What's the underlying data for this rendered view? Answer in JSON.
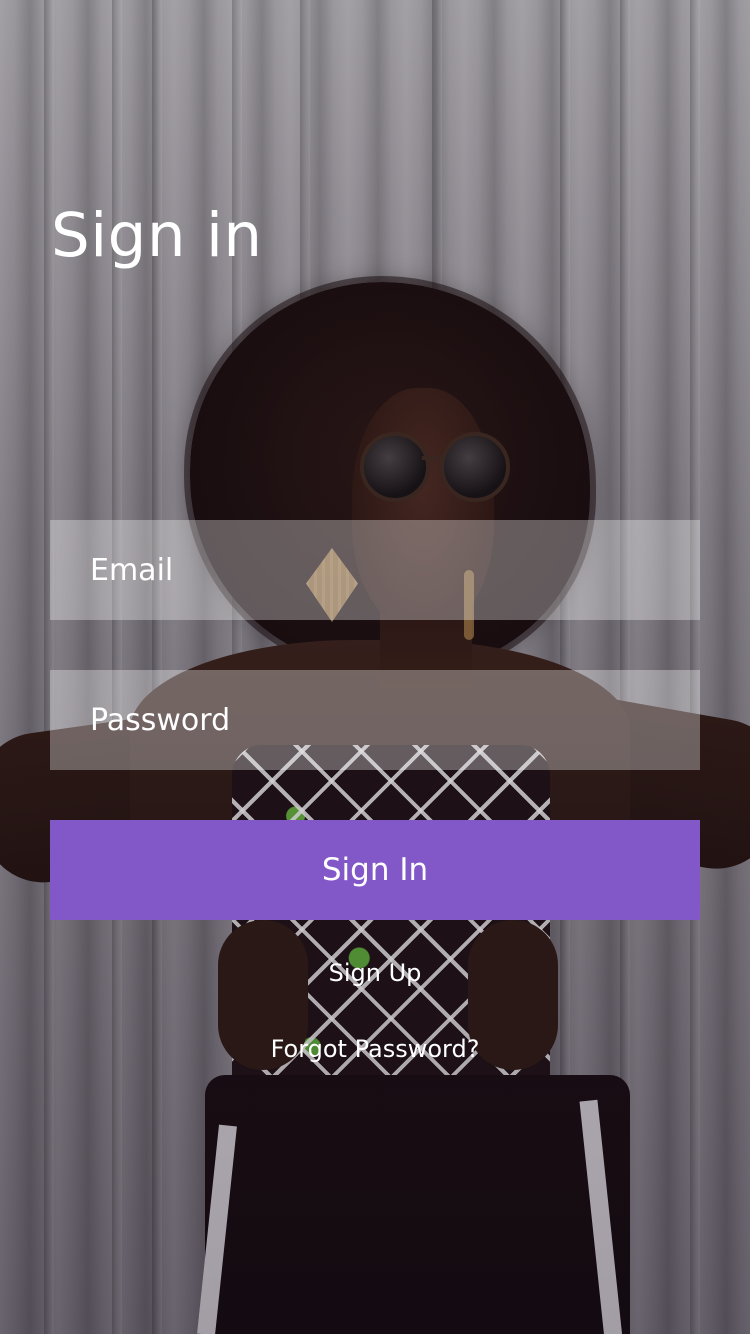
{
  "page": {
    "title": "Sign in"
  },
  "form": {
    "email_placeholder": "Email",
    "password_placeholder": "Password",
    "submit_label": "Sign In"
  },
  "links": {
    "signup_label": "Sign Up",
    "forgot_label": "Forgot Password?"
  },
  "colors": {
    "accent": "#8257c8",
    "field_background": "rgba(255,255,255,0.32)",
    "text": "#ffffff"
  }
}
